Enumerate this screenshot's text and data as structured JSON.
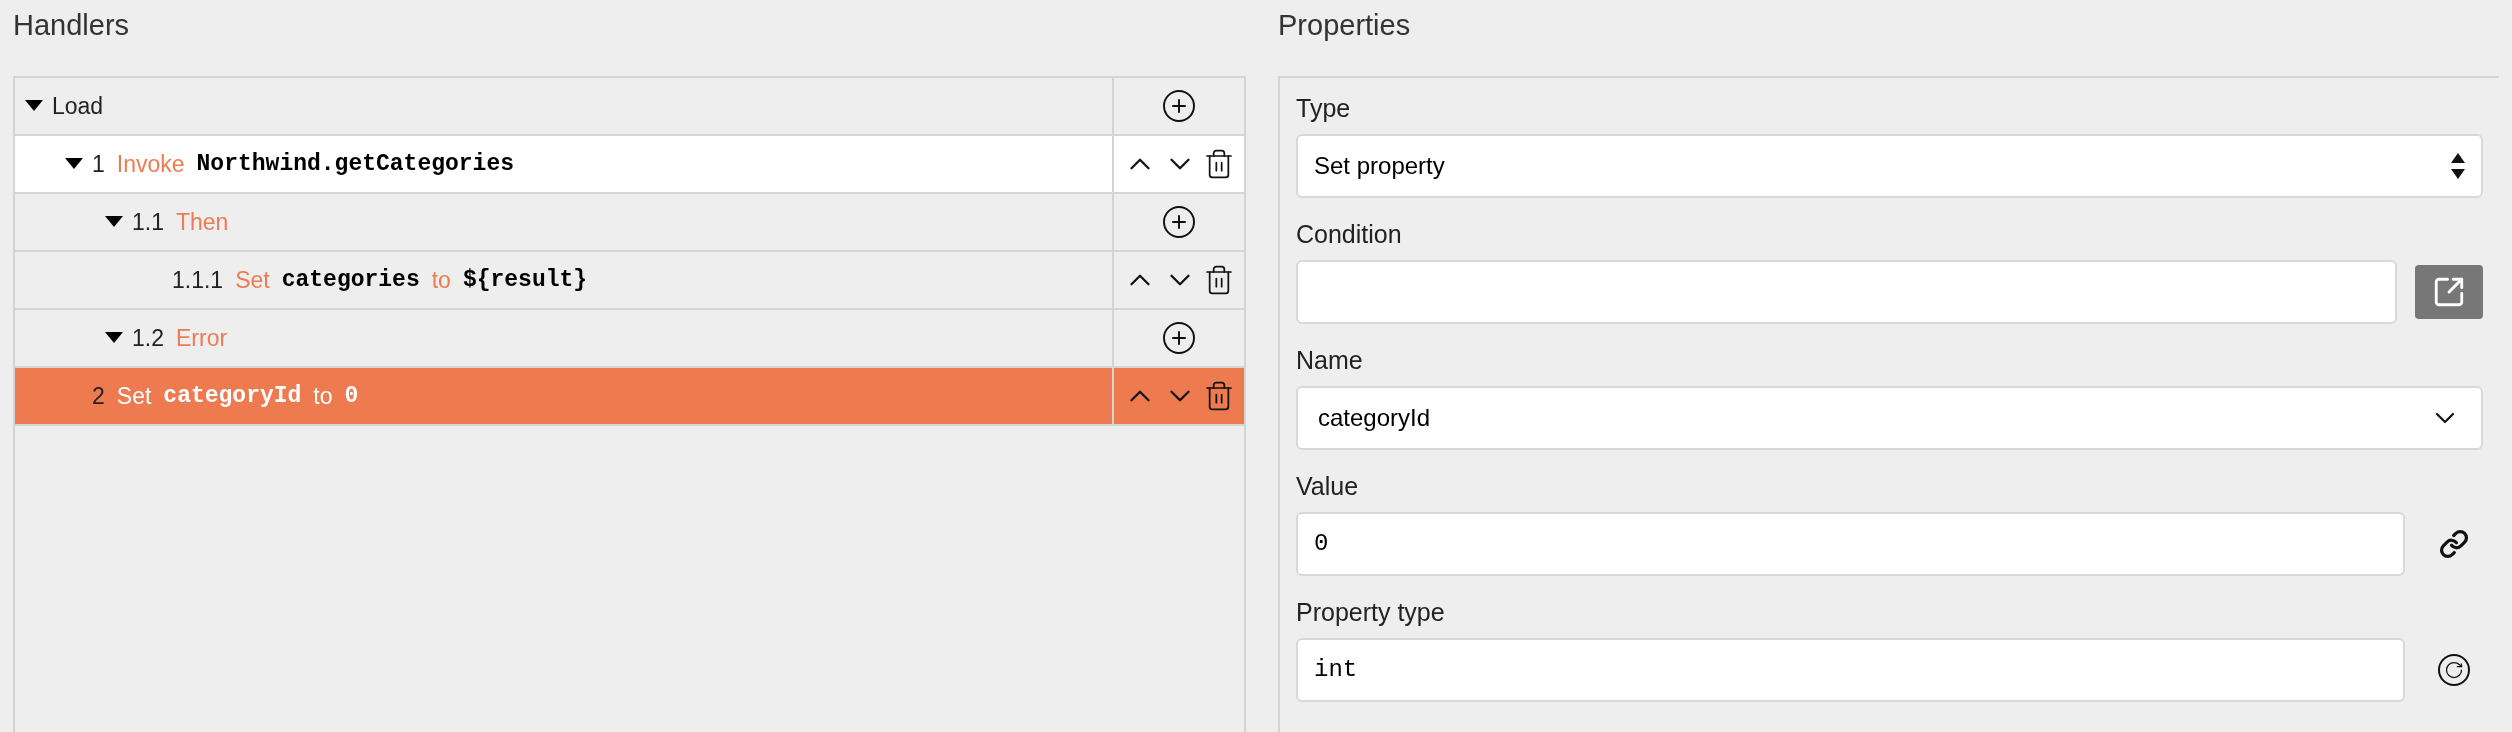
{
  "handlers": {
    "title": "Handlers",
    "tree": [
      {
        "kind": "group",
        "expanded": true,
        "hovered": false,
        "selected": false,
        "parts": [
          {
            "kind": "plain",
            "text": "Load"
          }
        ],
        "children": [
          {
            "kind": "step",
            "expanded": true,
            "hovered": true,
            "selected": false,
            "parts": [
              {
                "kind": "number",
                "text": "1"
              },
              {
                "kind": "keyword",
                "text": "Invoke"
              },
              {
                "kind": "code",
                "text": "Northwind.getCategories"
              }
            ],
            "children": [
              {
                "kind": "group",
                "expanded": true,
                "hovered": false,
                "selected": false,
                "parts": [
                  {
                    "kind": "number",
                    "text": "1.1"
                  },
                  {
                    "kind": "keyword",
                    "text": "Then"
                  }
                ],
                "children": [
                  {
                    "kind": "step",
                    "hovered": false,
                    "selected": false,
                    "parts": [
                      {
                        "kind": "number",
                        "text": "1.1.1"
                      },
                      {
                        "kind": "keyword",
                        "text": "Set"
                      },
                      {
                        "kind": "code",
                        "text": "categories"
                      },
                      {
                        "kind": "keyword",
                        "text": "to"
                      },
                      {
                        "kind": "code",
                        "text": "${result}"
                      }
                    ]
                  }
                ]
              },
              {
                "kind": "group",
                "expanded": true,
                "hovered": false,
                "selected": false,
                "parts": [
                  {
                    "kind": "number",
                    "text": "1.2"
                  },
                  {
                    "kind": "keyword",
                    "text": "Error"
                  }
                ]
              }
            ]
          },
          {
            "kind": "step",
            "hovered": false,
            "selected": true,
            "parts": [
              {
                "kind": "number",
                "text": "2"
              },
              {
                "kind": "keyword",
                "text": "Set"
              },
              {
                "kind": "code",
                "text": "categoryId"
              },
              {
                "kind": "keyword",
                "text": "to"
              },
              {
                "kind": "code",
                "text": "0"
              }
            ]
          }
        ]
      }
    ]
  },
  "properties": {
    "title": "Properties",
    "fields": [
      {
        "kind": "native-select",
        "label": "Type",
        "value": "Set property"
      },
      {
        "kind": "popout-input",
        "label": "Condition"
      },
      {
        "kind": "dropdown",
        "label": "Name",
        "value": "categoryId"
      },
      {
        "kind": "link-input",
        "label": "Value",
        "value": "0"
      },
      {
        "kind": "reset-input",
        "label": "Property type",
        "value": "int"
      }
    ]
  }
}
